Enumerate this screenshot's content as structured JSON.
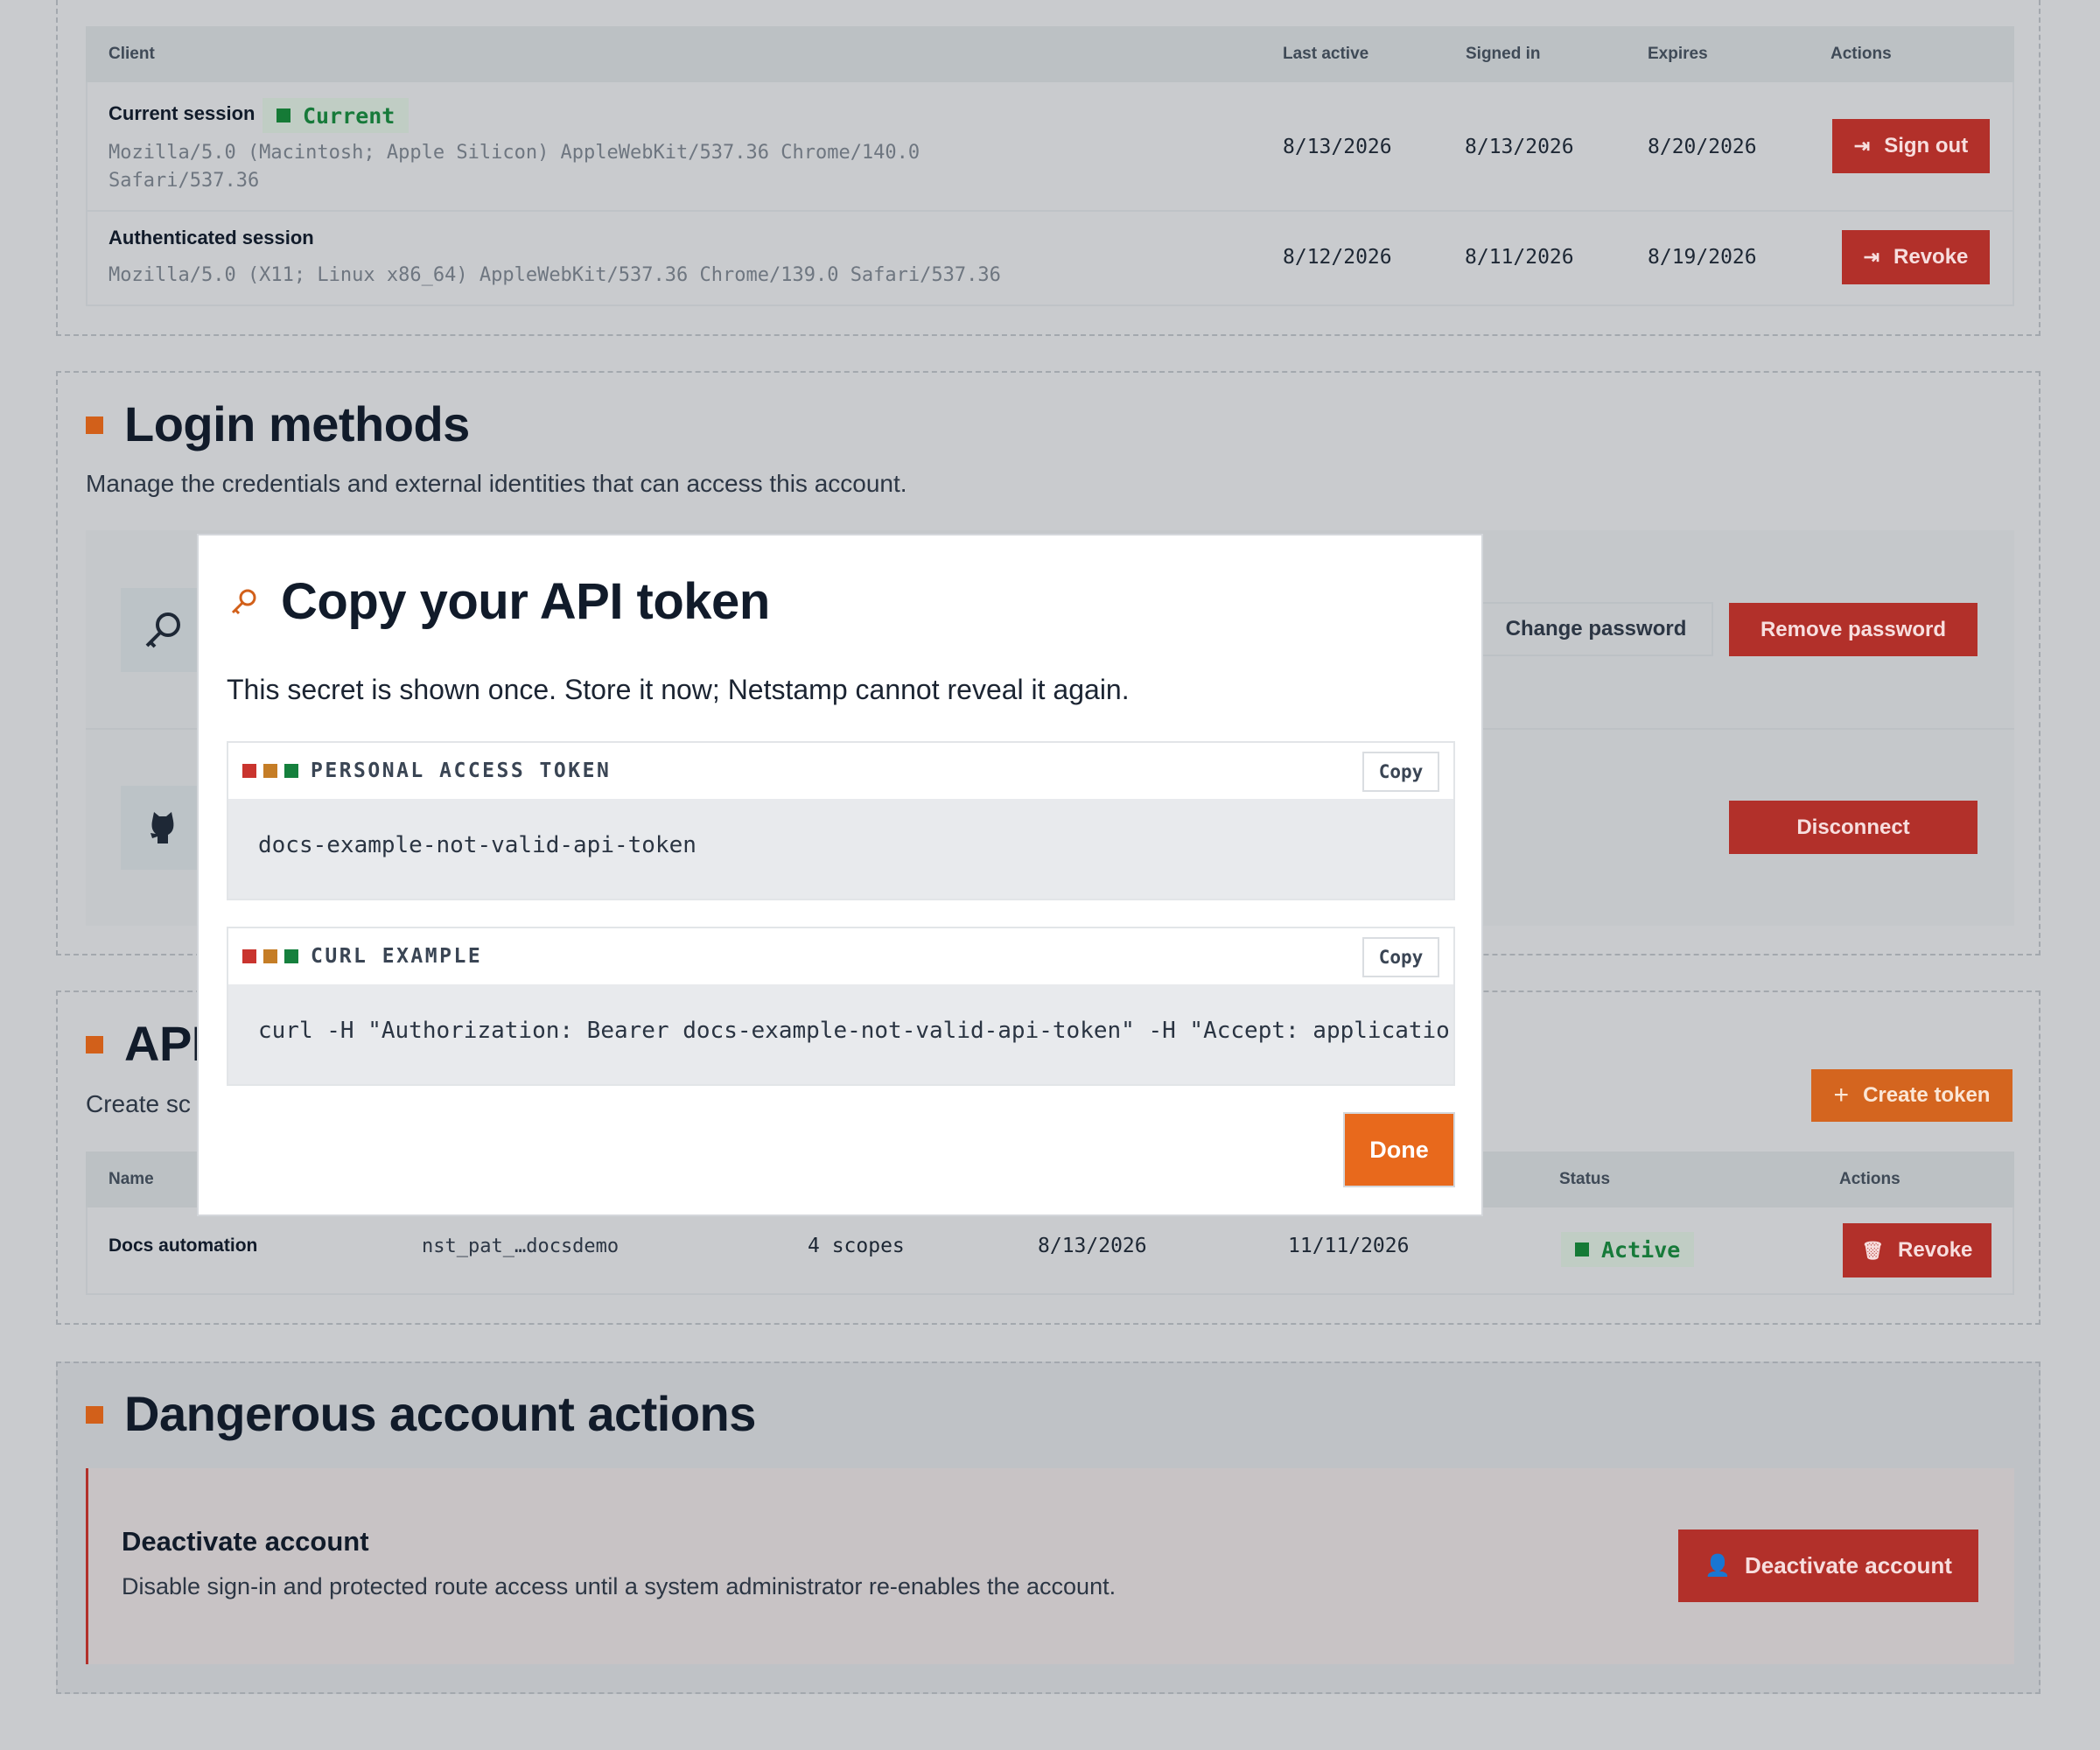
{
  "sessions": {
    "columns": [
      "Client",
      "Last active",
      "Signed in",
      "Expires",
      "Actions"
    ],
    "rows": [
      {
        "title": "Current session",
        "badge": "Current",
        "ua_line1": "Mozilla/5.0 (Macintosh; Apple Silicon) AppleWebKit/537.36 Chrome/140.0",
        "ua_line2": "Safari/537.36",
        "last_active": "8/13/2026",
        "signed_in": "8/13/2026",
        "expires": "8/20/2026",
        "action": "Sign out"
      },
      {
        "title": "Authenticated session",
        "ua_line1": "Mozilla/5.0 (X11; Linux x86_64) AppleWebKit/537.36 Chrome/139.0 Safari/537.36",
        "last_active": "8/12/2026",
        "signed_in": "8/11/2026",
        "expires": "8/19/2026",
        "action": "Revoke"
      }
    ]
  },
  "login_methods": {
    "title": "Login methods",
    "description": "Manage the credentials and external identities that can access this account.",
    "change_password": "Change password",
    "remove_password": "Remove password",
    "disconnect": "Disconnect"
  },
  "api_tokens": {
    "title_visible": "API",
    "desc_visible": "Create sc",
    "create_button": "Create token",
    "columns": {
      "name": "Name",
      "status": "Status",
      "actions": "Actions"
    },
    "rows": [
      {
        "name": "Docs automation",
        "prefix": "nst_pat_…docsdemo",
        "scopes": "4 scopes",
        "created": "8/13/2026",
        "expires": "11/11/2026",
        "status": "Active",
        "action": "Revoke"
      }
    ]
  },
  "danger": {
    "title": "Dangerous account actions",
    "card_title": "Deactivate account",
    "card_desc": "Disable sign-in and protected route access until a system administrator re-enables the account.",
    "button": "Deactivate account"
  },
  "modal": {
    "title": "Copy your API token",
    "message": "This secret is shown once. Store it now; Netstamp cannot reveal it again.",
    "token_label": "PERSONAL ACCESS TOKEN",
    "token_value": "docs-example-not-valid-api-token",
    "curl_label": "CURL EXAMPLE",
    "curl_value": "curl -H \"Authorization: Bearer docs-example-not-valid-api-token\" -H \"Accept: applicatior",
    "copy_label": "Copy",
    "done_label": "Done"
  },
  "colors": {
    "accent": "#d2601a",
    "danger": "#b2302a",
    "success": "#157a36",
    "overlay": "#c9cbce"
  }
}
